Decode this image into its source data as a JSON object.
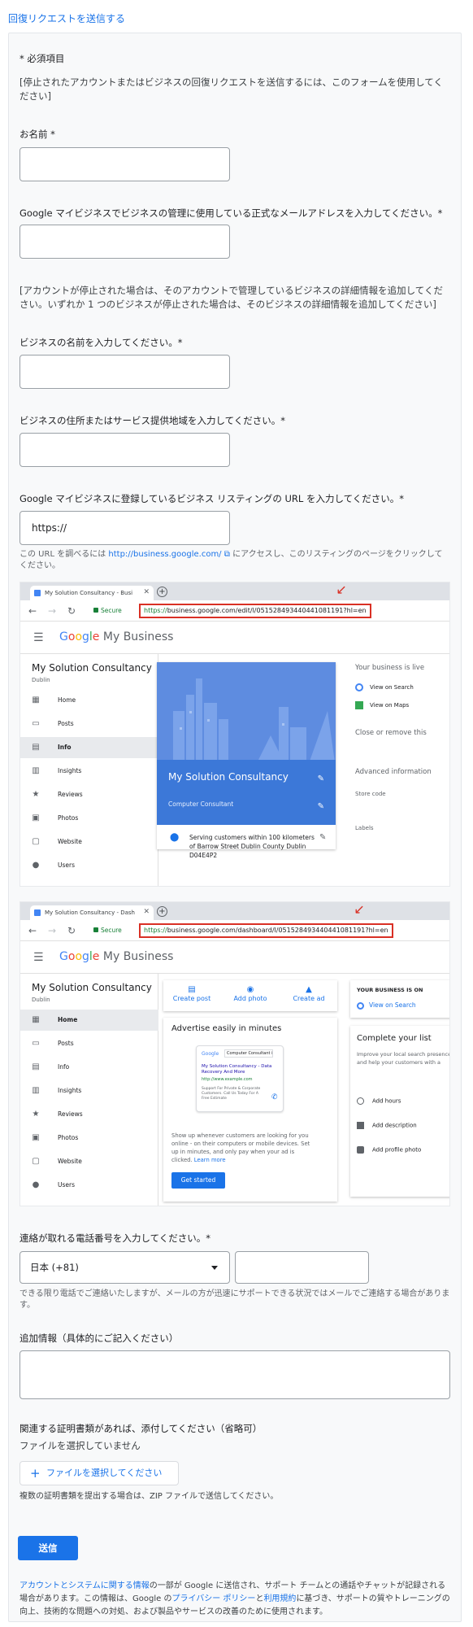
{
  "top_link": "回復リクエストを送信する",
  "form": {
    "required_note": "* 必須項目",
    "intro": "[停止されたアカウントまたはビジネスの回復リクエストを送信するには、このフォームを使用してください]",
    "name_label": "お名前 *",
    "email_label": "Google マイビジネスでビジネスの管理に使用している正式なメールアドレスを入力してください。*",
    "biz_section_note": "[アカウントが停止された場合は、そのアカウントで管理しているビジネスの詳細情報を追加してください。いずれか 1 つのビジネスが停止された場合は、そのビジネスの詳細情報を追加してください]",
    "biz_name_label": "ビジネスの名前を入力してください。*",
    "biz_address_label": "ビジネスの住所またはサービス提供地域を入力してください。*",
    "listing_url_label": "Google マイビジネスに登録しているビジネス リスティングの URL を入力してください。*",
    "listing_url_value": "https://",
    "url_help_prefix": "この URL を調べるには",
    "url_help_link": "http://business.google.com/",
    "url_help_suffix": "にアクセスし、このリスティングのページをクリックしてください。",
    "phone_label": "連絡が取れる電話番号を入力してください。*",
    "country_select": "日本 (+81)",
    "phone_note": "できる限り電話でご連絡いたしますが、メールの方が迅速にサポートできる状況ではメールでご連絡する場合があります。",
    "extra_label": "追加情報（具体的にご記入ください）",
    "attach_label": "関連する証明書類があれば、添付してください（省略可）",
    "no_file": "ファイルを選択していません",
    "file_button": "ファイルを選択してください",
    "file_note": "複数の証明書類を提出する場合は、ZIP ファイルで送信してください。",
    "submit": "送信",
    "footer_link1": "アカウントとシステムに関する情報",
    "footer_text1": "の一部が Google に送信され、サポート チームとの通話やチャットが記録される場合があります。この情報は、Google の",
    "footer_link2": "プライバシー ポリシー",
    "footer_text2": "と",
    "footer_link3": "利用規約",
    "footer_text3": "に基づき、サポートの質やトレーニングの向上、技術的な問題への対処、および製品やサービスの改善のために使用されます。"
  },
  "shot1": {
    "tab_title": "My Solution Consultancy - Busi",
    "secure": "Secure",
    "url_green": "https://",
    "url_rest": "business.google.com/edit/l/051528493440441081191?hl=en",
    "logo_google": "Google",
    "logo_mb": "My Business",
    "biz_name": "My Solution Consultancy",
    "city": "Dublin",
    "nav": [
      "Home",
      "Posts",
      "Info",
      "Insights",
      "Reviews",
      "Photos",
      "Website",
      "Users"
    ],
    "card_name": "My Solution Consultancy",
    "card_category": "Computer Consultant",
    "card_address": "Serving customers within 100 kilometers of Barrow Street Dublin County Dublin D04E4P2",
    "right_title": "Your business is live",
    "right_search": "View on Search",
    "right_maps": "View on Maps",
    "right_close": "Close or remove this",
    "right_adv": "Advanced information",
    "right_store": "Store code",
    "right_labels": "Labels"
  },
  "shot2": {
    "tab_title": "My Solution Consultancy - Dash",
    "secure": "Secure",
    "url_green": "https://",
    "url_rest": "business.google.com/dashboard/l/051528493440441081191?hl=en",
    "logo_google": "Google",
    "logo_mb": "My Business",
    "biz_name": "My Solution Consultancy",
    "city": "Dublin",
    "nav": [
      "Home",
      "Posts",
      "Info",
      "Insights",
      "Reviews",
      "Photos",
      "Website",
      "Users"
    ],
    "actions": [
      "Create post",
      "Add photo",
      "Create ad"
    ],
    "adv_title": "Advertise easily in minutes",
    "phone_search": "Computer Consultant in Du...",
    "phone_ad_title": "My Solution Consultancy - Data Recovery And More",
    "phone_ad_url": "http://www.example.com",
    "phone_ad_desc": "Support For Private & Corporate Customers. Call Us Today For A Free Estimate",
    "adv_body": "Show up whenever customers are looking for you online - on their computers or mobile devices. Set up in minutes, and only pay when your ad is clicked.",
    "learn_more": "Learn more",
    "get_started": "Get started",
    "right_live": "YOUR BUSINESS IS ON",
    "right_view": "View on Search",
    "right_complete": "Complete your list",
    "right_improve": "Improve your local search presence and help your customers with a",
    "right_hours": "Add hours",
    "right_desc": "Add description",
    "right_photo": "Add profile photo"
  }
}
